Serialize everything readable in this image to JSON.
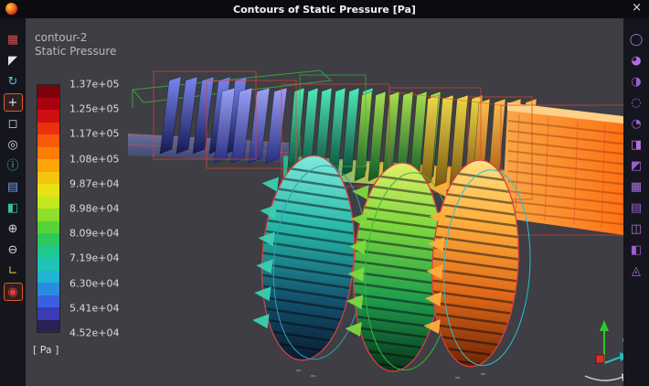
{
  "window": {
    "title": "Contours of Static Pressure [Pa]",
    "close": "×"
  },
  "legend": {
    "name": "contour-2",
    "field": "Static Pressure",
    "unit": "[ Pa ]",
    "ticks": [
      "1.37e+05",
      "1.25e+05",
      "1.17e+05",
      "1.08e+05",
      "9.87e+04",
      "8.98e+04",
      "8.09e+04",
      "7.19e+04",
      "6.30e+04",
      "5.41e+04",
      "4.52e+04"
    ],
    "colors": [
      "#7e0308",
      "#a80010",
      "#cc1010",
      "#ea3010",
      "#f85a0a",
      "#fc7e08",
      "#fca40a",
      "#f4c40e",
      "#e8e214",
      "#c2e81e",
      "#8ede2a",
      "#55d438",
      "#2cc85c",
      "#1fc88e",
      "#1fc4b4",
      "#22b4d4",
      "#2a8ce0",
      "#3a60e0",
      "#3a3cb4",
      "#2a2156"
    ]
  },
  "left_toolbar": {
    "items": [
      {
        "name": "scene-display-icon",
        "glyph": "▦",
        "color": "#c85050"
      },
      {
        "name": "select-pointer-icon",
        "glyph": "◤",
        "color": "#e8e8e8"
      },
      {
        "name": "rotate-view-icon",
        "glyph": "↻",
        "color": "#58c8d8"
      },
      {
        "name": "pan-view-icon",
        "glyph": "+",
        "color": "#e8e8e8",
        "active": true
      },
      {
        "name": "zoom-box-icon",
        "glyph": "◻",
        "color": "#d8d8d8"
      },
      {
        "name": "magnifier-icon",
        "glyph": "◎",
        "color": "#d8d8d8"
      },
      {
        "name": "info-icon",
        "glyph": "ⓘ",
        "color": "#40c8d8"
      },
      {
        "name": "display-panel-icon",
        "glyph": "▤",
        "color": "#6a9ae0"
      },
      {
        "name": "contour-tool-icon",
        "glyph": "◧",
        "color": "#40b8a0"
      },
      {
        "name": "zoom-in-icon",
        "glyph": "⊕",
        "color": "#d8d8d8"
      },
      {
        "name": "zoom-out-icon",
        "glyph": "⊖",
        "color": "#d8d8d8"
      },
      {
        "name": "axes-icon",
        "glyph": "∟",
        "color": "#d8c840"
      },
      {
        "name": "camera-record-icon",
        "glyph": "◉",
        "color": "#e04040",
        "active": true
      }
    ]
  },
  "right_toolbar": {
    "items": [
      {
        "name": "ellipse-view-icon",
        "glyph": "◯",
        "color": "#b070e0"
      },
      {
        "name": "sphere-view-icon",
        "glyph": "◕",
        "color": "#b070e0"
      },
      {
        "name": "orbit-view-icon",
        "glyph": "◑",
        "color": "#9a5fd0"
      },
      {
        "name": "section-ellipse-icon",
        "glyph": "◌",
        "color": "#b070e0"
      },
      {
        "name": "rotate-object-icon",
        "glyph": "◔",
        "color": "#9a5fd0"
      },
      {
        "name": "mirror-icon",
        "glyph": "◨",
        "color": "#b070e0"
      },
      {
        "name": "plot-icon",
        "glyph": "◩",
        "color": "#9a5fd0"
      },
      {
        "name": "grid-icon",
        "glyph": "▦",
        "color": "#b070e0"
      },
      {
        "name": "list-icon",
        "glyph": "▤",
        "color": "#9a5fd0"
      },
      {
        "name": "panel-icon",
        "glyph": "◫",
        "color": "#b070e0"
      },
      {
        "name": "box-icon",
        "glyph": "◧",
        "color": "#9a5fd0"
      },
      {
        "name": "probe-icon",
        "glyph": "◬",
        "color": "#b070e0"
      }
    ]
  }
}
